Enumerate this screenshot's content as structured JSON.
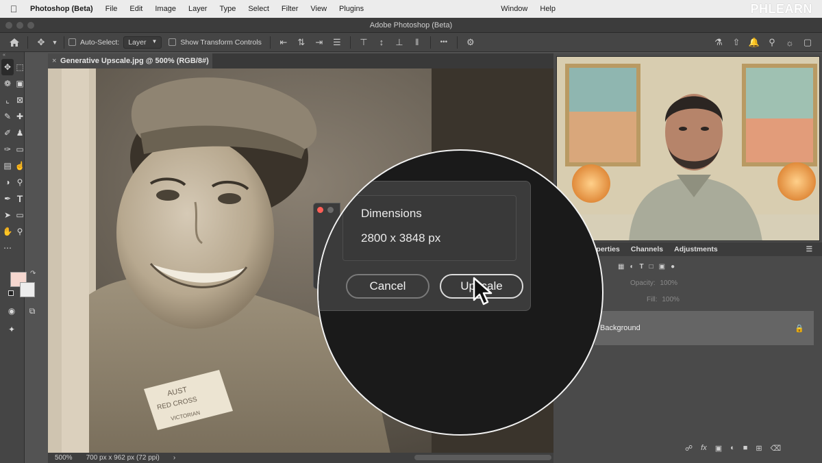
{
  "menubar": {
    "app_name": "Photoshop (Beta)",
    "items": [
      "File",
      "Edit",
      "Image",
      "Layer",
      "Type",
      "Select",
      "Filter",
      "View",
      "Plugins"
    ],
    "right_items": [
      "Window",
      "Help"
    ],
    "brand": "PHLEARN"
  },
  "window": {
    "title": "Adobe Photoshop (Beta)"
  },
  "options_bar": {
    "auto_select_label": "Auto-Select:",
    "auto_select_value": "Layer",
    "transform_label": "Show Transform Controls",
    "more_label": "•••"
  },
  "document": {
    "tab_title": "Generative Upscale.jpg @ 500% (RGB/8#) *",
    "zoom": "500%",
    "size_info": "700 px x 962 px (72 ppi)"
  },
  "dialog": {
    "dimensions_label": "Dimensions",
    "dimensions_value": "2800 x 3848 px",
    "cancel_label": "Cancel",
    "ok_label": "Upscale"
  },
  "panels": {
    "tabs": [
      "operties",
      "Channels",
      "Adjustments"
    ],
    "opacity_label": "Opacity:",
    "opacity_value": "100%",
    "fill_label": "Fill:",
    "fill_value": "100%",
    "layer_name": "Background"
  },
  "colors": {
    "foreground": "#f5d7cf",
    "background": "#ededed",
    "accent_close": "#ff5f57"
  }
}
